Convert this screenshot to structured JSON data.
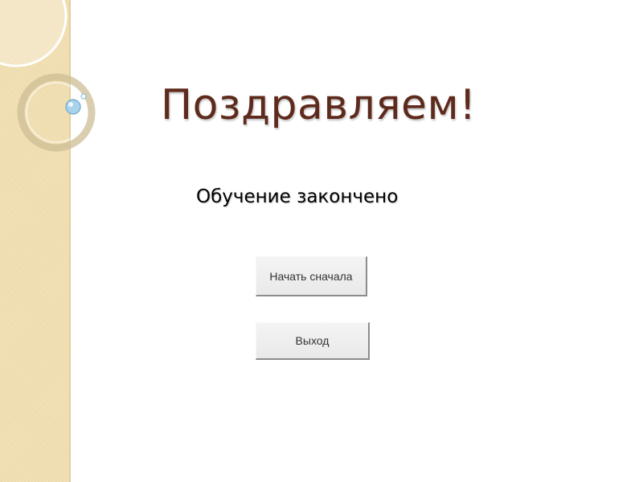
{
  "slide": {
    "title": "Поздравляем!",
    "subtitle": "Обучение закончено"
  },
  "buttons": {
    "restart_label": "Начать сначала",
    "exit_label": "Выход"
  },
  "colors": {
    "title": "#5e2a1c",
    "side_panel": "#f1deb0",
    "button_face": "#ececec"
  }
}
